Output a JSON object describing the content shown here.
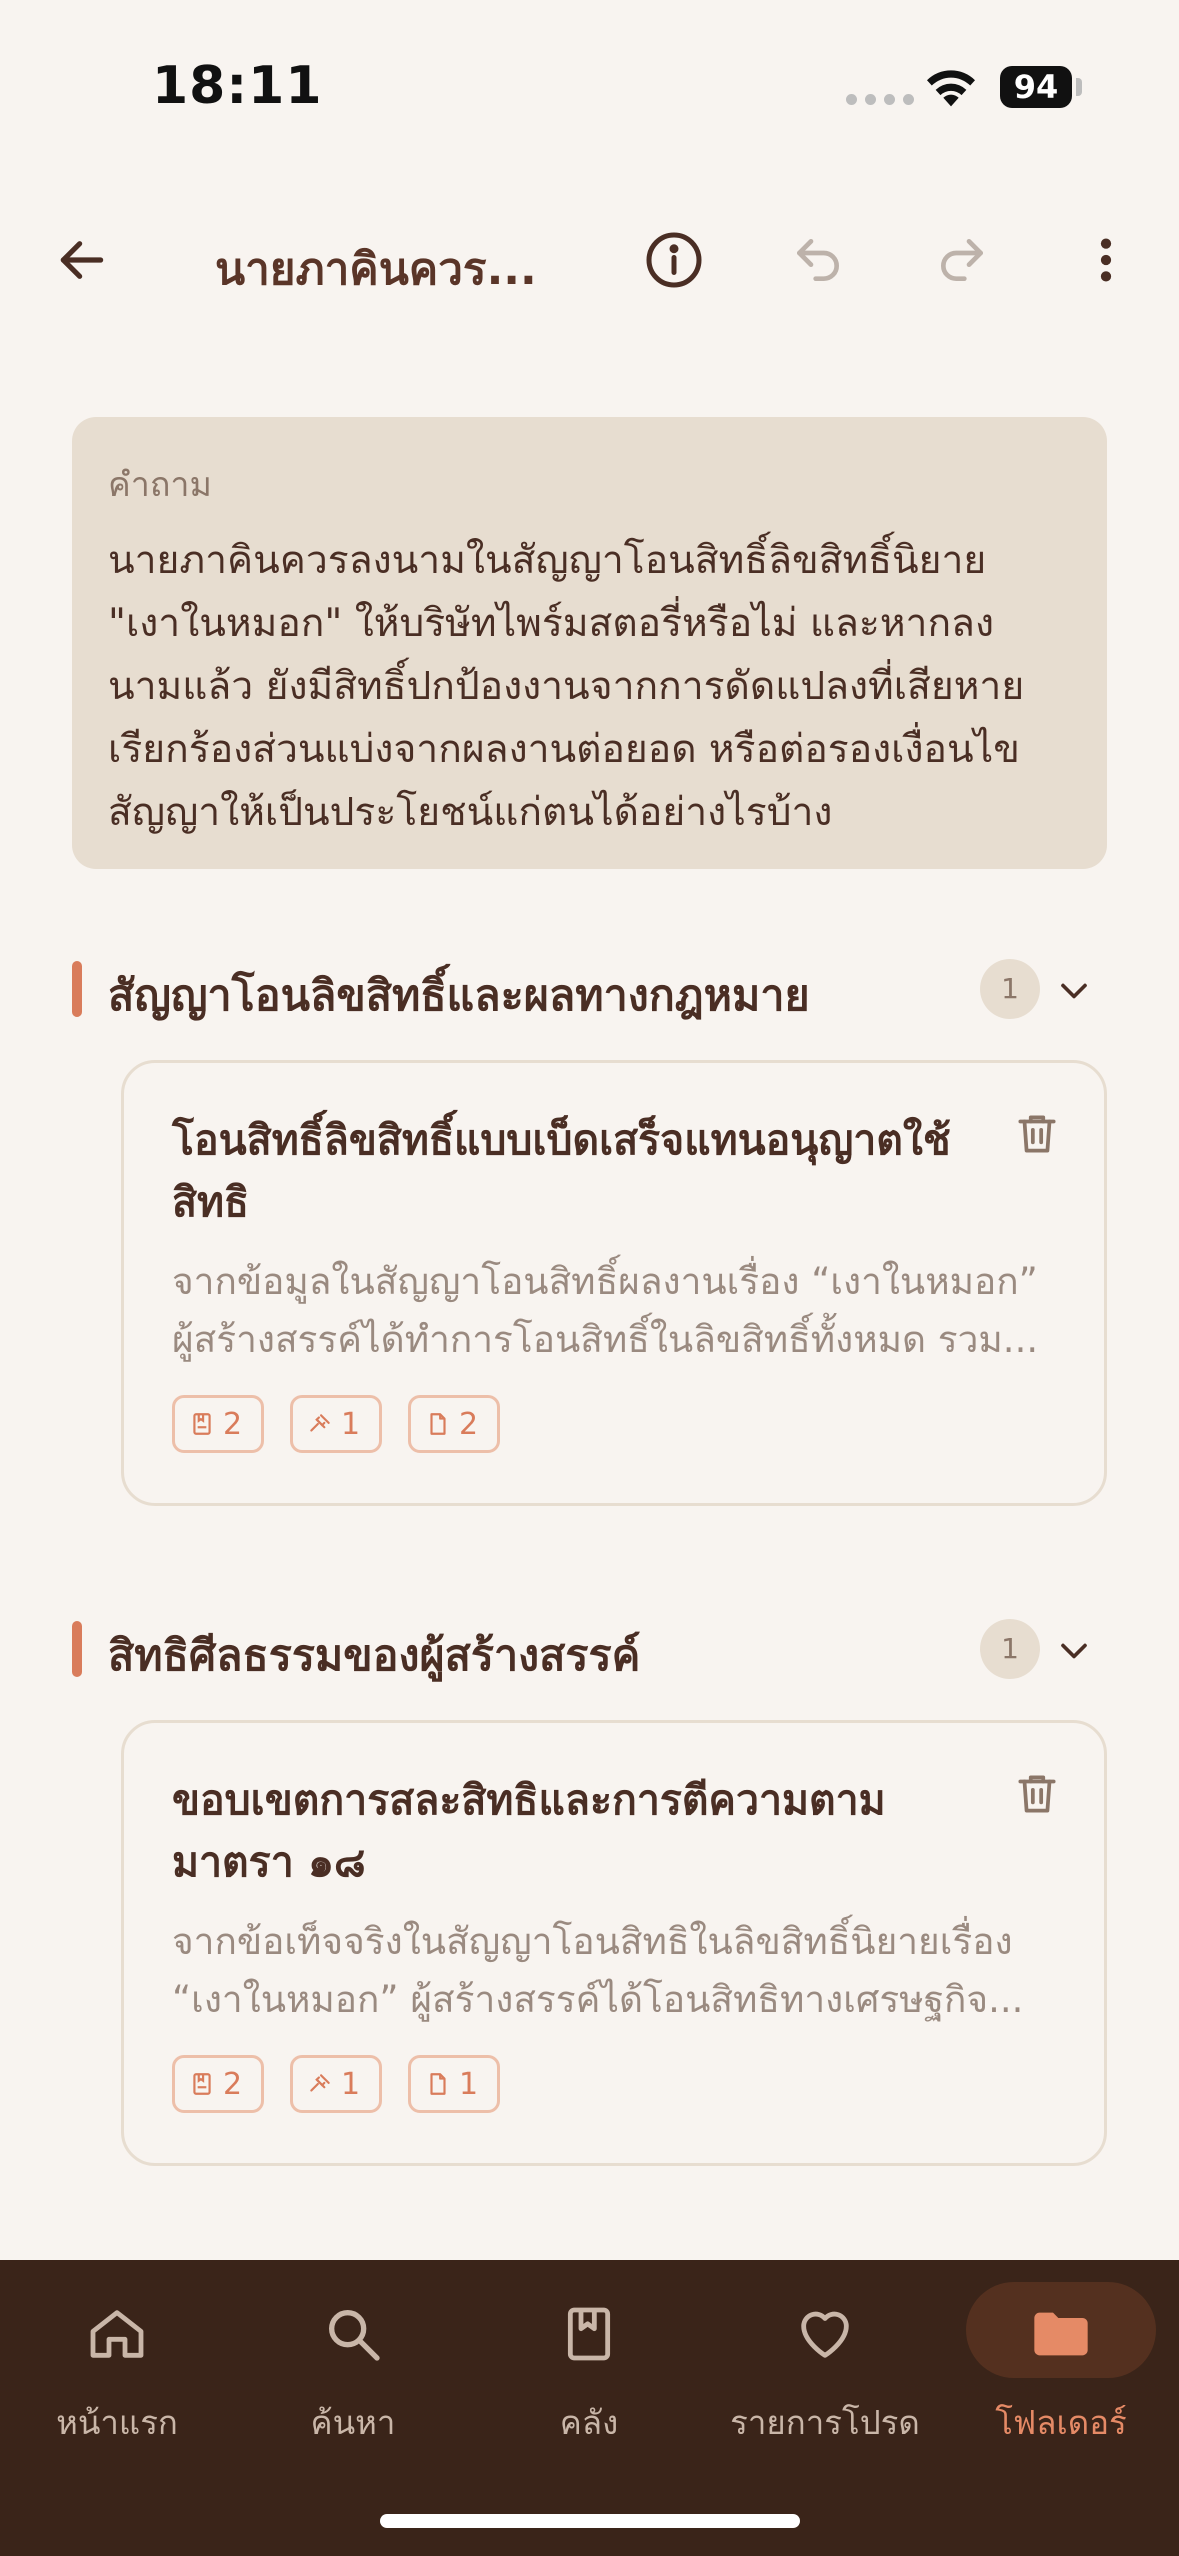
{
  "status_bar": {
    "time": "18:11",
    "battery": "94"
  },
  "header": {
    "title": "นายภาคินควร..."
  },
  "question": {
    "label": "คำถาม",
    "lines": [
      "นายภาคินควรลงนามในสัญญาโอนสิทธิ์ลิขสิทธิ์นิยาย",
      "\"เงาในหมอก\" ให้บริษัทไพร์มสตอรี่หรือไม่ และหากลง",
      "นามแล้ว ยังมีสิทธิ์ปกป้องงานจากการดัดแปลงที่เสียหาย",
      "เรียกร้องส่วนแบ่งจากผลงานต่อยอด หรือต่อรองเงื่อนไข",
      "สัญญาให้เป็นประโยชน์แก่ตนได้อย่างไรบ้าง"
    ]
  },
  "sections": [
    {
      "title": "สัญญาโอนลิขสิทธิ์และผลทางกฎหมาย",
      "count": "1",
      "card": {
        "title_lines": [
          "โอนสิทธิ์ลิขสิทธิ์แบบเบ็ดเสร็จแทนอนุญาตใช้",
          "สิทธิ"
        ],
        "desc_lines": [
          "จากข้อมูลในสัญญาโอนสิทธิ์ผลงานเรื่อง “เงาในหมอก”",
          "ผู้สร้างสรรค์ได้ทำการโอนสิทธิ์ในลิขสิทธิ์ทั้งหมด รวม..."
        ],
        "chips": [
          "2",
          "1",
          "2"
        ]
      }
    },
    {
      "title": "สิทธิศีลธรรมของผู้สร้างสรรค์",
      "count": "1",
      "card": {
        "title_lines": [
          "ขอบเขตการสละสิทธิและการตีความตาม",
          "มาตรา ๑๘"
        ],
        "desc_lines": [
          "จากข้อเท็จจริงในสัญญาโอนสิทธิในลิขสิทธิ์นิยายเรื่อง",
          "“เงาในหมอก” ผู้สร้างสรรค์ได้โอนสิทธิทางเศรษฐกิจ..."
        ],
        "chips": [
          "2",
          "1",
          "1"
        ]
      }
    }
  ],
  "nav": [
    {
      "label": "หน้าแรก",
      "icon": "home-icon"
    },
    {
      "label": "ค้นหา",
      "icon": "search-icon"
    },
    {
      "label": "คลัง",
      "icon": "bookmark-book-icon"
    },
    {
      "label": "รายการโปรด",
      "icon": "heart-icon"
    },
    {
      "label": "โฟลเดอร์",
      "icon": "folder-icon",
      "active": true
    }
  ],
  "colors": {
    "accent": "#D97C5B",
    "background": "#F8F4F0",
    "nav_background": "#3A2419",
    "question_background": "#E7DDD0"
  }
}
